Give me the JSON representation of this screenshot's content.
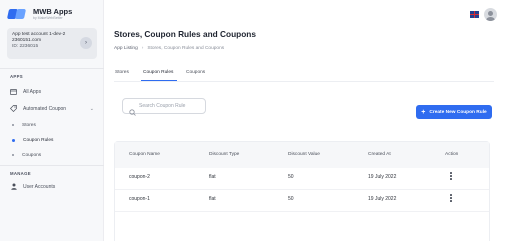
{
  "app": {
    "title": "MWB Apps",
    "subtitle": "by MakeWebBetter"
  },
  "account": {
    "name": "App test account 1-dev-2",
    "code": "2360151.com",
    "id": "ID: 2236015"
  },
  "sidebar": {
    "apps_label": "APPS",
    "items": [
      {
        "label": "All Apps",
        "icon": "apps-icon"
      },
      {
        "label": "Automated Coupon",
        "icon": "coupon-icon"
      }
    ],
    "sub_items": [
      {
        "label": "Stores"
      },
      {
        "label": "Coupon Rules"
      },
      {
        "label": "Coupons"
      }
    ],
    "manage_label": "MANAGE",
    "manage_items": [
      {
        "label": "User Accounts",
        "icon": "user-icon"
      }
    ]
  },
  "header": {
    "language_flag": "uk-flag-icon",
    "avatar": "avatar-icon"
  },
  "page": {
    "title": "Stores, Coupon Rules and Coupons",
    "breadcrumb": [
      "App Listing",
      "Stores, Coupon Rules and Coupons"
    ]
  },
  "tabs": [
    {
      "label": "Stores"
    },
    {
      "label": "Coupon Rules"
    },
    {
      "label": "Coupons"
    }
  ],
  "active_tab": "Coupon Rules",
  "search": {
    "placeholder": "Search Coupon Rule",
    "value": ""
  },
  "create_button": {
    "label": "Create New Coupon Rule"
  },
  "table": {
    "columns": [
      "Coupon Name",
      "Discount Type",
      "Discount Value",
      "Created At",
      "Action"
    ],
    "rows": [
      [
        "coupon-2",
        "flat",
        "50",
        "19 July 2022"
      ],
      [
        "coupon-1",
        "flat",
        "50",
        "19 July 2022"
      ]
    ]
  },
  "colors": {
    "accent": "#2f6cf0",
    "sidebar_bg": "#f7f8fa",
    "header_row_bg": "#f6f7f9"
  }
}
